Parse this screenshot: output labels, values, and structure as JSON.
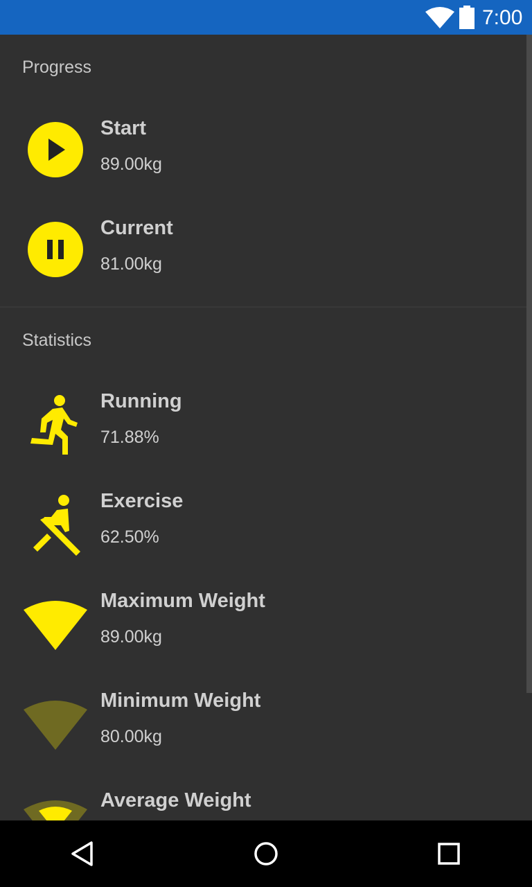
{
  "status_bar": {
    "time": "7:00",
    "icons": [
      "wifi-icon",
      "battery-icon"
    ],
    "background": "#1565C0"
  },
  "progress": {
    "header": "Progress",
    "items": [
      {
        "icon": "play-icon",
        "title": "Start",
        "value": "89.00kg"
      },
      {
        "icon": "pause-icon",
        "title": "Current",
        "value": "81.00kg"
      }
    ]
  },
  "statistics": {
    "header": "Statistics",
    "items": [
      {
        "icon": "running-icon",
        "title": "Running",
        "value": "71.88%"
      },
      {
        "icon": "exercise-icon",
        "title": "Exercise",
        "value": "62.50%"
      },
      {
        "icon": "maximum-weight-icon",
        "title": "Maximum Weight",
        "value": "89.00kg"
      },
      {
        "icon": "minimum-weight-icon",
        "title": "Minimum Weight",
        "value": "80.00kg"
      },
      {
        "icon": "average-weight-icon",
        "title": "Average Weight",
        "value": ""
      }
    ]
  },
  "nav_bar": {
    "buttons": [
      "back-icon",
      "home-icon",
      "recents-icon"
    ]
  },
  "colors": {
    "accent": "#FFEB00",
    "accent_dim": "#6F6A22",
    "background": "#303030",
    "text": "#D0D0D0"
  }
}
